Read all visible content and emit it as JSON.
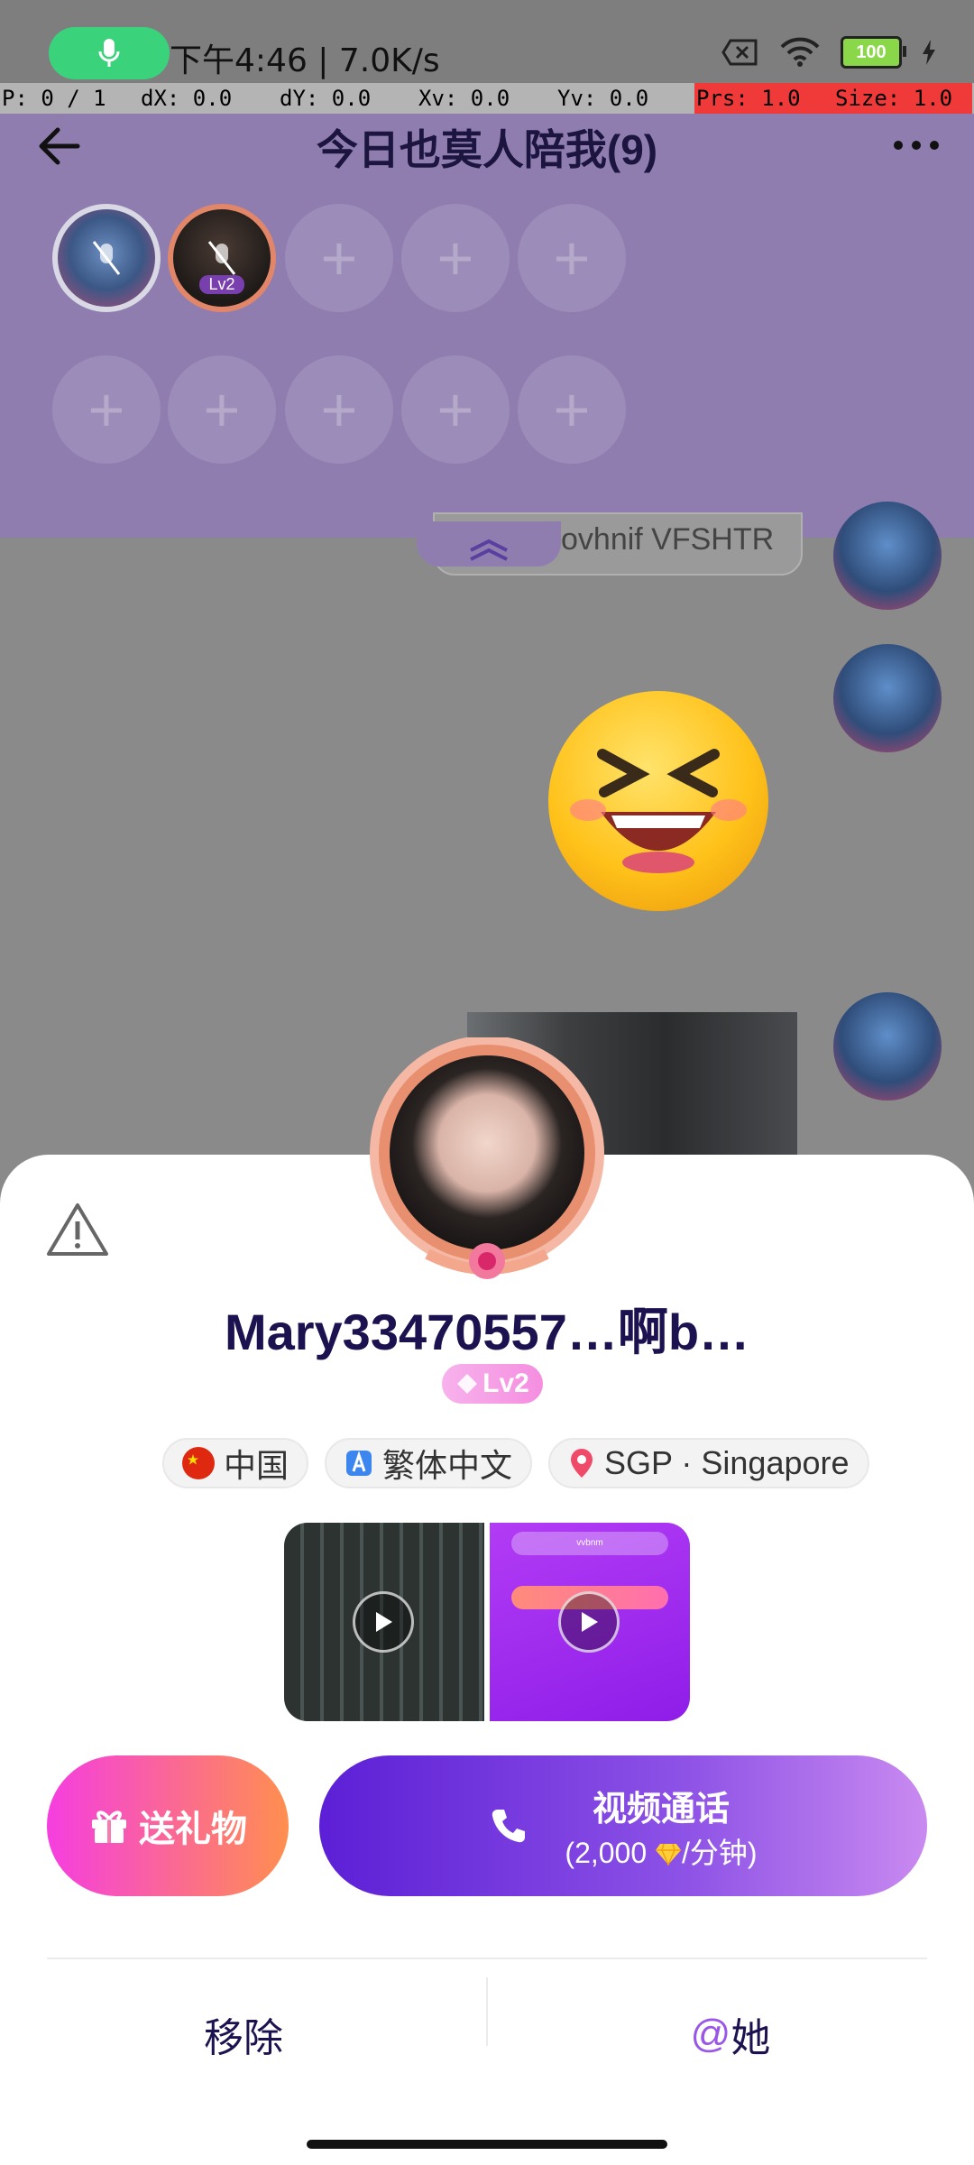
{
  "status_bar": {
    "time_speed": "下午4:46 | 7.0K/s",
    "battery": "100"
  },
  "debug": {
    "p": "P: 0 / 1",
    "dx": "dX: 0.0",
    "dy": "dY: 0.0",
    "xv": "Xv: 0.0",
    "yv": "Yv: 0.0",
    "prs": "Prs: 1.0",
    "size": "Size: 1.0"
  },
  "header": {
    "title": "今日也莫人陪我(9)",
    "seat_level": "Lv2"
  },
  "chat": {
    "partial_message": "ovhnif VFSHTR"
  },
  "profile": {
    "username": "Mary33470557…啊b…",
    "level": "Lv2",
    "tags": [
      {
        "icon": "china-flag-icon",
        "label": "中国"
      },
      {
        "icon": "language-icon",
        "label": "繁体中文"
      },
      {
        "icon": "location-pin-icon",
        "label": "SGP · Singapore"
      }
    ],
    "media_overlay_text": "vvbnm"
  },
  "actions": {
    "gift_label": "送礼物",
    "call_title": "视频通话",
    "call_price_prefix": "(2,000 ",
    "call_price_suffix": "/分钟)",
    "remove_label": "移除",
    "at_symbol": "@",
    "at_label": "她"
  },
  "colors": {
    "header_bg": "#8f7db0",
    "title": "#1d1250",
    "gift_gradient_start": "#f53ee0",
    "gift_gradient_end": "#ff8f4f",
    "call_gradient_start": "#5c1fd6",
    "call_gradient_end": "#c98af0",
    "at_accent": "#9a56e6"
  }
}
